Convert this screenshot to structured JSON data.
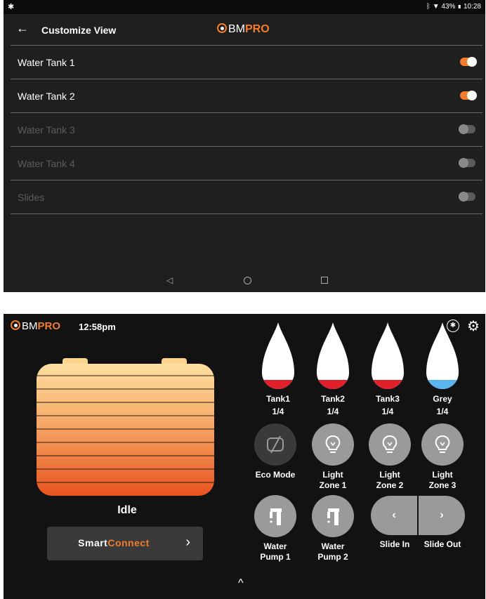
{
  "top": {
    "status": {
      "left_icon": "gear-icon",
      "bluetooth": "bluetooth-icon",
      "wifi": "wifi-icon",
      "battery": "43%",
      "time": "10:28"
    },
    "app_bar": {
      "back_icon": "back-arrow-icon",
      "title": "Customize View",
      "logo_bm": "BM",
      "logo_pro": "PRO"
    },
    "rows": [
      {
        "label": "Water Tank 1",
        "enabled": true
      },
      {
        "label": "Water Tank 2",
        "enabled": true
      },
      {
        "label": "Water Tank 3",
        "enabled": false
      },
      {
        "label": "Water Tank 4",
        "enabled": false
      },
      {
        "label": "Slides",
        "enabled": false
      }
    ],
    "nav": {
      "back_glyph": "◁"
    }
  },
  "bottom": {
    "logo_bm": "BM",
    "logo_pro": "PRO",
    "time": "12:58pm",
    "bluetooth_glyph": "✱",
    "gear_glyph": "⚙",
    "battery_state": "Idle",
    "smartconnect": {
      "part1": "Smart",
      "part2": "Connect",
      "chevron": "›"
    },
    "tanks": [
      {
        "name": "Tank1",
        "level": "1/4",
        "color": "#e0202a"
      },
      {
        "name": "Tank2",
        "level": "1/4",
        "color": "#e0202a"
      },
      {
        "name": "Tank3",
        "level": "1/4",
        "color": "#e0202a"
      },
      {
        "name": "Grey",
        "level": "1/4",
        "color": "#5ab4ee"
      }
    ],
    "controls": {
      "eco": "Eco Mode",
      "light1_a": "Light",
      "light1_b": "Zone 1",
      "light2_a": "Light",
      "light2_b": "Zone 2",
      "light3_a": "Light",
      "light3_b": "Zone 3",
      "pump1_a": "Water",
      "pump1_b": "Pump 1",
      "pump2_a": "Water",
      "pump2_b": "Pump 2",
      "slide_in": "Slide In",
      "slide_out": "Slide Out",
      "slide_in_glyph": "‹",
      "slide_out_glyph": "›"
    },
    "up_glyph": "^"
  }
}
